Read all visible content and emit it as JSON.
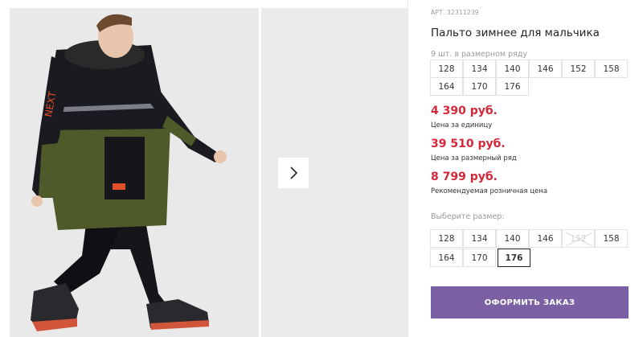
{
  "product": {
    "article": "АРТ. 32311239",
    "title": "Пальто зимнее для мальчика"
  },
  "size_row": {
    "label": "9 шт. в размерном ряду",
    "sizes": [
      "128",
      "134",
      "140",
      "146",
      "152",
      "158",
      "164",
      "170",
      "176"
    ]
  },
  "prices": {
    "unit_price": "4 390 руб.",
    "unit_note": "Цена за единицу",
    "row_price": "39 510 руб.",
    "row_note": "Цена за размерный ряд",
    "retail_price": "8 799 руб.",
    "retail_note": "Рекомендуемая розничная цена"
  },
  "size_picker": {
    "label": "Выберите размер:",
    "sizes": [
      "128",
      "134",
      "140",
      "146",
      "152",
      "158",
      "164",
      "170",
      "176"
    ],
    "unavailable": [
      "152"
    ],
    "selected": "176"
  },
  "order_button": {
    "label": "ОФОРМИТЬ ЗАКАЗ"
  },
  "gallery": {
    "next_icon": "chevron-right-icon"
  },
  "colors": {
    "price": "#d4283a",
    "button": "#7b60a3",
    "coat_dark": "#1a1a20",
    "coat_green": "#4e5a2a",
    "accent_orange": "#e0502a"
  }
}
